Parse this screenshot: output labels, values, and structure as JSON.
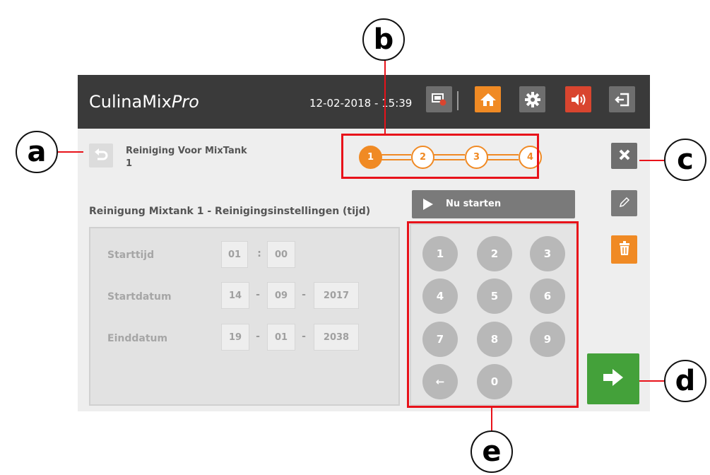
{
  "app": {
    "brand": "CulinaMix",
    "brand_suffix": "Pro",
    "datetime": "12-02-2018 - 15:39"
  },
  "toolbar": {
    "icons": [
      "screen-settings-icon",
      "home-icon",
      "gear-icon",
      "speaker-icon",
      "logout-icon"
    ],
    "colors": {
      "bar": "#3a3a3a",
      "home": "#f08a24",
      "speaker": "#d9452f",
      "neutral": "#6e6e6e"
    }
  },
  "record": {
    "title_line1": "Reiniging Voor MixTank",
    "title_line2": "1"
  },
  "steps": [
    "1",
    "2",
    "3",
    "4"
  ],
  "active_step": "1",
  "section_title": "Reinigung Mixtank 1 - Reinigingsinstellingen (tijd)",
  "start_button": "Nu starten",
  "settings": {
    "start_time": {
      "label": "Starttijd",
      "hour": "01",
      "sep": ":",
      "minute": "00"
    },
    "start_date": {
      "label": "Startdatum",
      "day": "14",
      "month": "09",
      "year": "2017",
      "sep": "-"
    },
    "end_date": {
      "label": "Einddatum",
      "day": "19",
      "month": "01",
      "year": "2038",
      "sep": "-"
    }
  },
  "keypad": {
    "keys": [
      "1",
      "2",
      "3",
      "4",
      "5",
      "6",
      "7",
      "8",
      "9",
      "←",
      "0"
    ]
  },
  "callouts": {
    "a": "a",
    "b": "b",
    "c": "c",
    "d": "d",
    "e": "e"
  },
  "colors": {
    "accent": "#f08a24",
    "next": "#44a13a",
    "callout_line": "#e8121a"
  }
}
